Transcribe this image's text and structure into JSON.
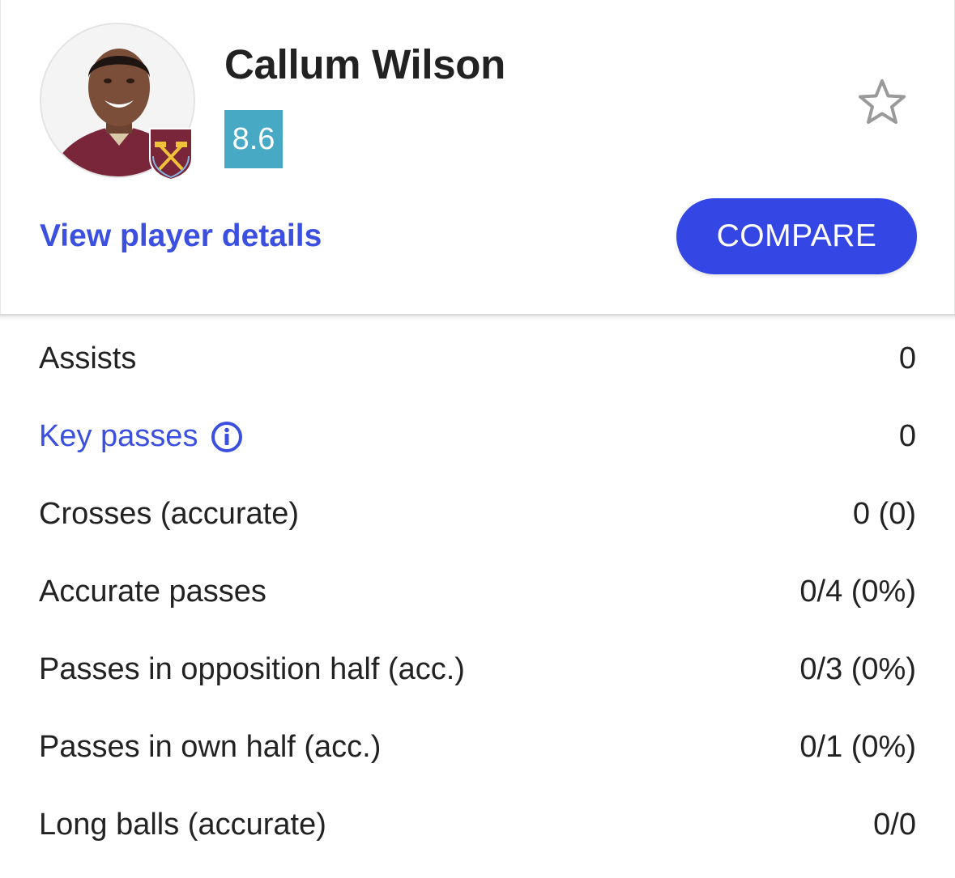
{
  "player": {
    "name": "Callum Wilson",
    "rating": "8.6",
    "club_badge_icon": "west-ham-united-crest-icon",
    "rating_color": "#47a9c4"
  },
  "actions": {
    "view_details_label": "View player details",
    "compare_label": "COMPARE",
    "favorite_icon": "star-outline-icon",
    "accent_color": "#3447e4"
  },
  "stats": [
    {
      "label": "Assists",
      "value": "0",
      "is_link": false
    },
    {
      "label": "Key passes",
      "value": "0",
      "is_link": true,
      "icon": "info-icon"
    },
    {
      "label": "Crosses (accurate)",
      "value": "0 (0)",
      "is_link": false
    },
    {
      "label": "Accurate passes",
      "value": "0/4 (0%)",
      "is_link": false
    },
    {
      "label": "Passes in opposition half (acc.)",
      "value": "0/3 (0%)",
      "is_link": false
    },
    {
      "label": "Passes in own half (acc.)",
      "value": "0/1 (0%)",
      "is_link": false
    },
    {
      "label": "Long balls (accurate)",
      "value": "0/0",
      "is_link": false
    }
  ]
}
